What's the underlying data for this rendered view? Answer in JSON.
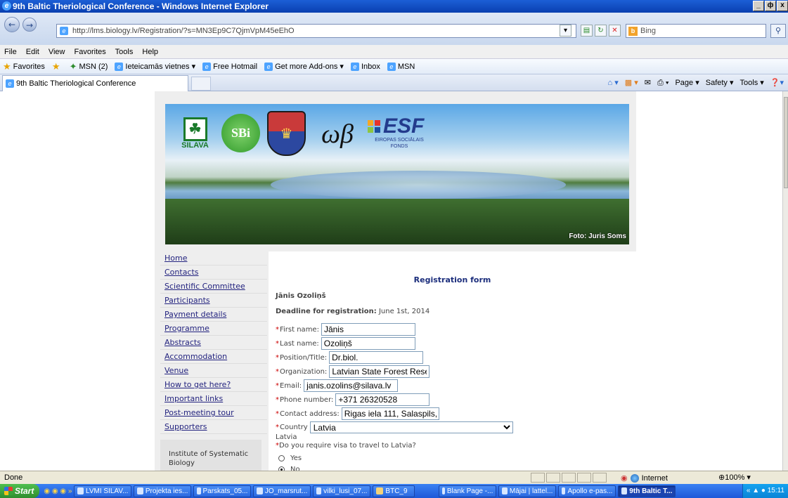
{
  "window": {
    "title": "9th Baltic Theriological Conference - Windows Internet Explorer",
    "minimize": "_",
    "restore": "ф",
    "close": "x"
  },
  "address": {
    "url": "http://lms.biology.lv/Registration/?s=MN3Ep9C7QjmVpM45eEhO",
    "search_engine": "Bing",
    "search_placeholder": "Bing"
  },
  "menu": [
    "File",
    "Edit",
    "View",
    "Favorites",
    "Tools",
    "Help"
  ],
  "favorites_bar": {
    "favorites_label": "Favorites",
    "items": [
      "MSN (2)",
      "Ieteicamās vietnes ▾",
      "Free Hotmail",
      "Get more Add-ons ▾",
      "Inbox",
      "MSN"
    ]
  },
  "tab": {
    "title": "9th Baltic Theriological Conference"
  },
  "command_bar": [
    "Page ▾",
    "Safety ▾",
    "Tools ▾"
  ],
  "banner": {
    "logo_silava": "SILAVA",
    "logo_sbi": "SBi",
    "logo_esf": "ESF",
    "logo_esf_sub": "EIROPAS SOCIĀLAIS FONDS",
    "photo_credit": "Foto: Juris Soms"
  },
  "sidebar": {
    "items": [
      {
        "label": "Home"
      },
      {
        "label": "Contacts"
      },
      {
        "label": "Scientific Committee"
      },
      {
        "label": "Participants"
      },
      {
        "label": "Payment details"
      },
      {
        "label": "Programme"
      },
      {
        "label": "Abstracts"
      },
      {
        "label": "Accommodation"
      },
      {
        "label": "Venue"
      },
      {
        "label": "How to get here?"
      },
      {
        "label": "Important links"
      },
      {
        "label": "Post-meeting tour"
      },
      {
        "label": "Supporters"
      }
    ],
    "box_text": "Institute of Systematic Biology"
  },
  "form": {
    "title": "Registration form",
    "user_name": "Jānis Ozoliņš",
    "deadline_label": "Deadline for registration:",
    "deadline_value": " June 1st, 2014",
    "required_mark": "*",
    "fields": {
      "first_name": {
        "label": "First name:",
        "value": "Jānis"
      },
      "last_name": {
        "label": "Last name:",
        "value": "Ozoliņš"
      },
      "position": {
        "label": "Position/Title:",
        "value": "Dr.biol."
      },
      "organization": {
        "label": "Organization:",
        "value": "Latvian State Forest Rese"
      },
      "email": {
        "label": "Email:",
        "value": "janis.ozolins@silava.lv"
      },
      "phone": {
        "label": "Phone number:",
        "value": "+371 26320528"
      },
      "address": {
        "label": "Contact address:",
        "value": "Rigas iela 111, Salaspils,"
      },
      "country": {
        "label": "Country",
        "value": "Latvia"
      }
    },
    "country_echo": "Latvia",
    "visa_question": "Do you require visa to travel to Latvia?",
    "visa_options": [
      {
        "label": "Yes",
        "selected": false
      },
      {
        "label": "No",
        "selected": true
      }
    ]
  },
  "status": {
    "text": "Done",
    "zone": "Internet",
    "zoom": "⊕100% ▾"
  },
  "taskbar": {
    "start": "Start",
    "tasks": [
      "LVMI SILAV...",
      "Projekta ies...",
      "Parskats_05...",
      "JO_marsrut...",
      "vilki_lusi_07...",
      "BTC_9",
      "Blank Page -...",
      "Mājai | lattel...",
      "Apollo e-pas...",
      "9th Baltic T..."
    ],
    "clock": "15:11"
  }
}
